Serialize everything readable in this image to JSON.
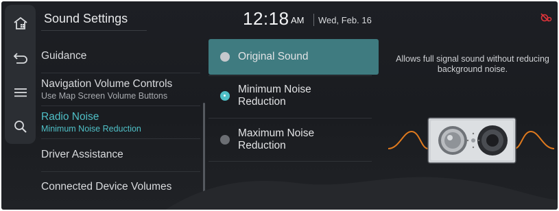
{
  "header": {
    "title": "Sound Settings",
    "time": "12:18",
    "ampm": "AM",
    "date": "Wed, Feb. 16"
  },
  "rail": {
    "items": [
      {
        "icon": "home-icon"
      },
      {
        "icon": "back-icon"
      },
      {
        "icon": "menu-icon"
      },
      {
        "icon": "search-icon"
      }
    ]
  },
  "menu": {
    "items": [
      {
        "label": "Guidance",
        "sub": ""
      },
      {
        "label": "Navigation Volume Controls",
        "sub": "Use Map Screen Volume Buttons"
      },
      {
        "label": "Radio Noise",
        "sub": "Minimum Noise Reduction",
        "active": true
      },
      {
        "label": "Driver Assistance",
        "sub": ""
      },
      {
        "label": "Connected Device Volumes",
        "sub": ""
      }
    ]
  },
  "options": [
    {
      "label": "Original Sound",
      "state": "highlighted"
    },
    {
      "label": "Minimum Noise Reduction",
      "state": "checked"
    },
    {
      "label": "Maximum Noise Reduction",
      "state": "unchecked"
    }
  ],
  "description": "Allows full signal sound without reducing background noise.",
  "colors": {
    "accent": "#4fc0c7",
    "highlight": "#3f7b80",
    "status_icon": "#e0333a",
    "wave": "#e07a1e"
  },
  "status": {
    "icon": "connection-off-icon"
  }
}
